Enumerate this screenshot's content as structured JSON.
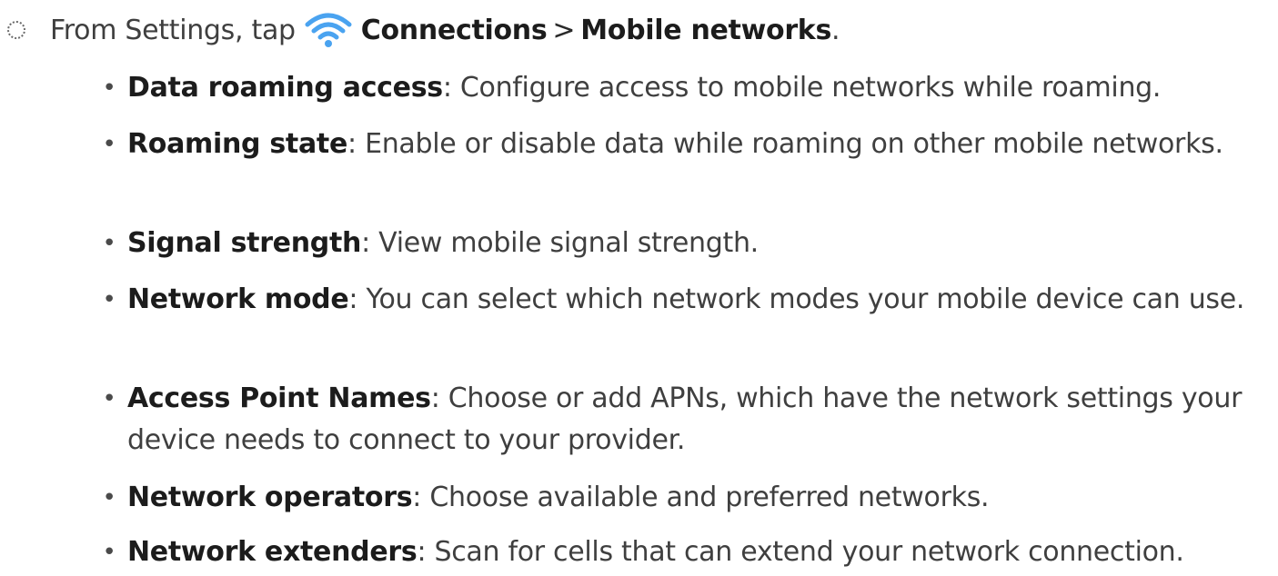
{
  "step": {
    "prefix": "From Settings, tap",
    "connections_label": "Connections",
    "chevron": ">",
    "mobile_networks_label": "Mobile networks",
    "suffix": ".",
    "icon": "wifi-icon",
    "icon_color": "#4aa3f0"
  },
  "items": [
    {
      "term": "Data roaming access",
      "sep": ":",
      "desc": " Configure access to mobile networks while roaming."
    },
    {
      "term": "Roaming state",
      "sep": ":",
      "desc": " Enable or disable data while roaming on other mobile networks."
    },
    {
      "term": "Signal strength",
      "sep": ":",
      "desc": " View mobile signal strength."
    },
    {
      "term": "Network mode",
      "sep": ":",
      "desc": " You can select which network modes your mobile device can use."
    },
    {
      "term": "Access Point Names",
      "sep": ":",
      "desc": " Choose or add APNs, which have the network settings your device needs to connect to your provider."
    },
    {
      "term": "Network operators",
      "sep": ":",
      "desc": " Choose available and preferred networks."
    },
    {
      "term": "Network extenders",
      "sep": ":",
      "desc": " Scan for cells that can extend your network connection."
    }
  ],
  "bullet": "•"
}
